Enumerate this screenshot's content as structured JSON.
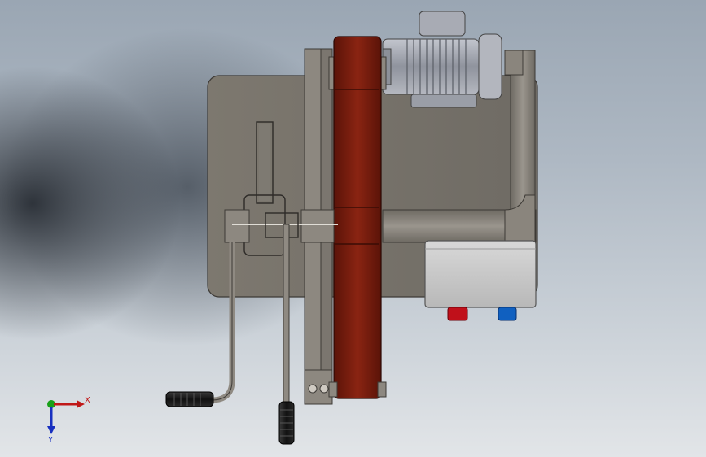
{
  "view": {
    "background_top": "#9aa6b3",
    "background_bottom": "#e2e5e8"
  },
  "model": {
    "plate_color": "#7a766f",
    "belt_color": "#7a1e10",
    "motor_color": "#9ea2ad",
    "box_color": "#c9c9c9",
    "button_red": "#c0101a",
    "button_blue": "#1060c0",
    "handle_color": "#222222"
  },
  "triad": {
    "x_label": "X",
    "y_label": "Y",
    "x_color": "#c01818",
    "y_color": "#1830c0",
    "z_color": "#18a018",
    "icons": [
      "axis-triad-icon"
    ]
  }
}
